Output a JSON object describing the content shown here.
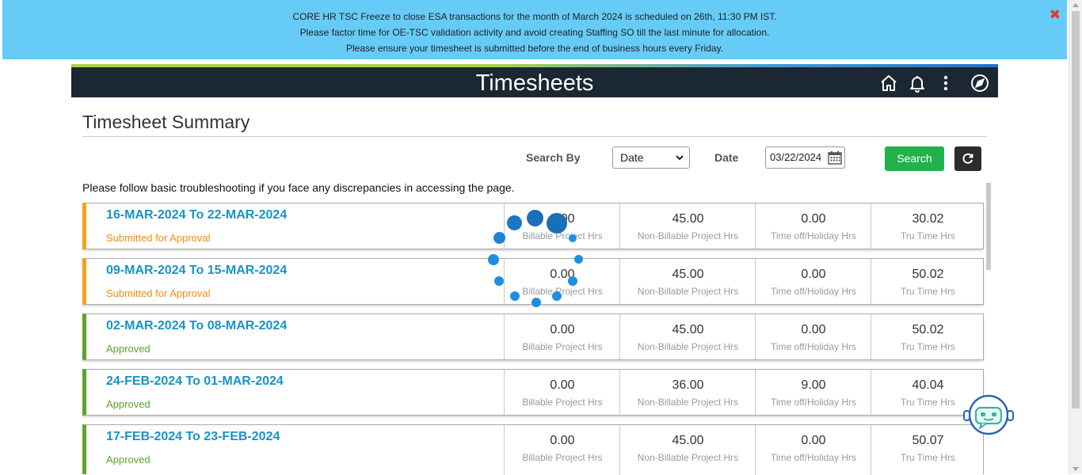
{
  "banner": {
    "lines": [
      "CORE HR TSC Freeze to close ESA transactions for the month of March 2024 is scheduled on 26th, 11:30 PM IST.",
      "Please factor time for OE-TSC validation activity and avoid creating Staffing SO till the last minute for allocation.",
      "Please ensure your timesheet is submitted before the end of business hours every Friday."
    ],
    "close_icon": "✖"
  },
  "header": {
    "title": "Timesheets",
    "icons": [
      "home-icon",
      "bell-icon",
      "more-vertical-icon",
      "compass-icon"
    ]
  },
  "summary": {
    "title": "Timesheet Summary"
  },
  "search": {
    "search_by_label": "Search By",
    "select_value": "Date",
    "date_label": "Date",
    "date_value": "03/22/2024",
    "search_button": "Search"
  },
  "note": "Please follow basic troubleshooting if you face any discrepancies in accessing the page.",
  "labels": {
    "billable": "Billable Project Hrs",
    "non_billable": "Non-Billable Project Hrs",
    "time_off": "Time off/Holiday Hrs",
    "tru_time": "Tru Time Hrs"
  },
  "timesheets": [
    {
      "range": "16-MAR-2024 To 22-MAR-2024",
      "status": "Submitted for Approval",
      "billable": "0.00",
      "non_billable": "45.00",
      "time_off": "0.00",
      "tru_time": "30.02"
    },
    {
      "range": "09-MAR-2024 To 15-MAR-2024",
      "status": "Submitted for Approval",
      "billable": "0.00",
      "non_billable": "45.00",
      "time_off": "0.00",
      "tru_time": "50.02"
    },
    {
      "range": "02-MAR-2024 To 08-MAR-2024",
      "status": "Approved",
      "billable": "0.00",
      "non_billable": "45.00",
      "time_off": "0.00",
      "tru_time": "50.02"
    },
    {
      "range": "24-FEB-2024 To 01-MAR-2024",
      "status": "Approved",
      "billable": "0.00",
      "non_billable": "36.00",
      "time_off": "9.00",
      "tru_time": "40.04"
    },
    {
      "range": "17-FEB-2024 To 23-FEB-2024",
      "status": "Approved",
      "billable": "0.00",
      "non_billable": "45.00",
      "time_off": "0.00",
      "tru_time": "50.07"
    }
  ],
  "colors": {
    "banner_bg": "#66ccf7",
    "header_bg": "#1b2733",
    "pending": "#f7a01b",
    "approved": "#5ba52a",
    "link": "#1893c5",
    "search_button": "#22b24c"
  }
}
